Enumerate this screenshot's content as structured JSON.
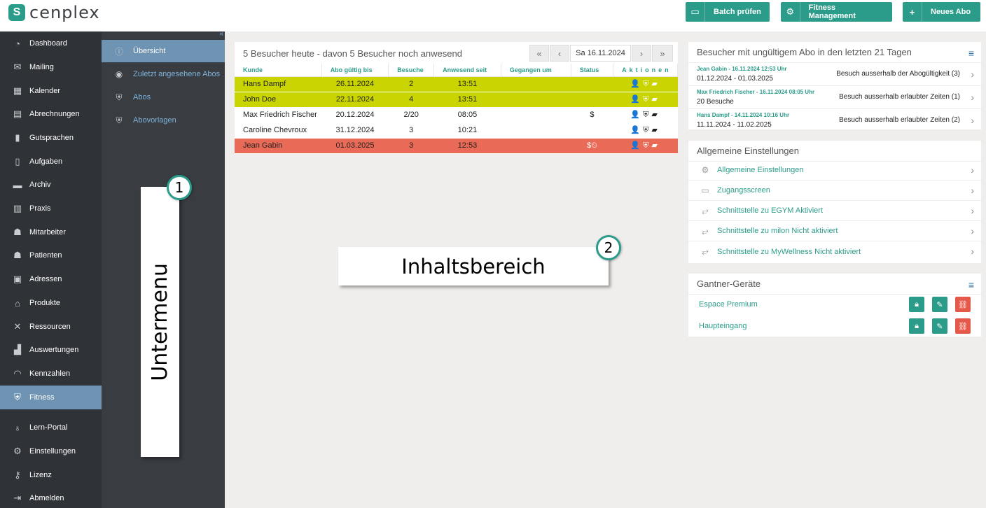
{
  "brand": {
    "logo_mark": "S",
    "name": "cenplex"
  },
  "toolbar": {
    "buttons": [
      {
        "label": "Batch prüfen",
        "icon": "card-icon"
      },
      {
        "label": "Fitness Management",
        "icon": "gear-icon"
      },
      {
        "label": "Neues Abo",
        "icon": "plus-icon"
      }
    ]
  },
  "sidebar": {
    "items": [
      {
        "label": "Dashboard",
        "icon": "dashboard-icon"
      },
      {
        "label": "Mailing",
        "icon": "mail-icon"
      },
      {
        "label": "Kalender",
        "icon": "calendar-icon"
      },
      {
        "label": "Abrechnungen",
        "icon": "calculator-icon"
      },
      {
        "label": "Gutsprachen",
        "icon": "document-icon"
      },
      {
        "label": "Aufgaben",
        "icon": "clipboard-icon"
      },
      {
        "label": "Archiv",
        "icon": "archive-icon"
      },
      {
        "label": "Praxis",
        "icon": "building-icon"
      },
      {
        "label": "Mitarbeiter",
        "icon": "staff-icon"
      },
      {
        "label": "Patienten",
        "icon": "patients-icon"
      },
      {
        "label": "Adressen",
        "icon": "address-icon"
      },
      {
        "label": "Produkte",
        "icon": "store-icon"
      },
      {
        "label": "Ressourcen",
        "icon": "tools-icon"
      },
      {
        "label": "Auswertungen",
        "icon": "chart-icon"
      },
      {
        "label": "Kennzahlen",
        "icon": "gauge-icon"
      },
      {
        "label": "Fitness",
        "icon": "shield-icon",
        "active": true
      },
      {
        "label": "Lern-Portal",
        "icon": "bulb-icon"
      },
      {
        "label": "Einstellungen",
        "icon": "gear-icon"
      },
      {
        "label": "Lizenz",
        "icon": "key-icon"
      },
      {
        "label": "Abmelden",
        "icon": "logout-icon"
      }
    ]
  },
  "submenu": {
    "collapse": "«",
    "items": [
      {
        "label": "Übersicht",
        "icon": "info-icon",
        "active": true
      },
      {
        "label": "Zuletzt angesehene Abos",
        "icon": "eye-icon"
      },
      {
        "label": "Abos",
        "icon": "shield-icon"
      },
      {
        "label": "Abovorlagen",
        "icon": "shield-list-icon"
      }
    ]
  },
  "annotations": {
    "sub_label": "Untermenu",
    "sub_number": "1",
    "content_label": "Inhaltsbereich",
    "content_number": "2"
  },
  "visitors": {
    "title": "5 Besucher heute - davon 5 Besucher noch anwesend",
    "nav": {
      "first": "«",
      "prev": "‹",
      "next": "›",
      "last": "»"
    },
    "date": "Sa  16.11.2024",
    "columns": [
      "Kunde",
      "Abo gültig bis",
      "Besuche",
      "Anwesend seit",
      "Gegangen um",
      "Status",
      "Aktionen"
    ],
    "rows": [
      {
        "name": "Hans Dampf",
        "valid": "26.11.2024",
        "visits": "2",
        "since": "13:51",
        "left": "",
        "status": "",
        "actions": "👤⛨▰",
        "color": "yellow"
      },
      {
        "name": "John Doe",
        "valid": "22.11.2024",
        "visits": "4",
        "since": "13:51",
        "left": "",
        "status": "",
        "actions": "👤⛨▰",
        "color": "yellow"
      },
      {
        "name": "Max Friedrich Fischer",
        "valid": "20.12.2024",
        "visits": "2/20",
        "since": "08:05",
        "left": "",
        "status": "$",
        "actions": "👤⛨▰",
        "color": "white"
      },
      {
        "name": "Caroline Chevroux",
        "valid": "31.12.2024",
        "visits": "3",
        "since": "10:21",
        "left": "",
        "status": "",
        "actions": "👤⛨▰",
        "color": "white"
      },
      {
        "name": "Jean Gabin",
        "valid": "01.03.2025",
        "visits": "3",
        "since": "12:53",
        "left": "",
        "status": "$⏲",
        "actions": "👤⛨▰",
        "color": "red"
      }
    ]
  },
  "invalid_visitors": {
    "title": "Besucher mit ungültigem Abo in den letzten 21 Tagen",
    "menu": "≡",
    "rows": [
      {
        "head": "Jean Gabin - 16.11.2024 12:53 Uhr",
        "sub": "01.12.2024 - 01.03.2025",
        "reason": "Besuch ausserhalb der Abogültigkeit (3)"
      },
      {
        "head": "Max Friedrich Fischer - 16.11.2024 08:05 Uhr",
        "sub": "20 Besuche",
        "reason": "Besuch ausserhalb erlaubter Zeiten (1)"
      },
      {
        "head": "Hans Dampf - 14.11.2024 10:16 Uhr",
        "sub": "11.11.2024 - 11.02.2025",
        "reason": "Besuch ausserhalb erlaubter Zeiten (2)"
      }
    ]
  },
  "general_settings": {
    "title": "Allgemeine Einstellungen",
    "rows": [
      {
        "label": "Allgemeine Einstellungen",
        "icon": "gear-icon"
      },
      {
        "label": "Zugangsscreen",
        "icon": "screen-icon"
      },
      {
        "label": "Schnittstelle zu EGYM Aktiviert",
        "icon": "interface-icon"
      },
      {
        "label": "Schnittstelle zu milon Nicht aktiviert",
        "icon": "interface-icon"
      },
      {
        "label": "Schnittstelle zu MyWellness Nicht aktiviert",
        "icon": "interface-icon"
      }
    ]
  },
  "gantner": {
    "title": "Gantner-Geräte",
    "menu": "≡",
    "devices": [
      {
        "label": "Espace Premium"
      },
      {
        "label": "Haupteingang"
      }
    ],
    "colors": {
      "teal": "#2c9c8a",
      "red": "#e5594b"
    }
  },
  "colors": {
    "accent": "#2c9c8a",
    "yellow_row": "#c9d400",
    "red_row": "#e96a56",
    "sidebar": "#2f3236",
    "active": "#6f93b2"
  }
}
